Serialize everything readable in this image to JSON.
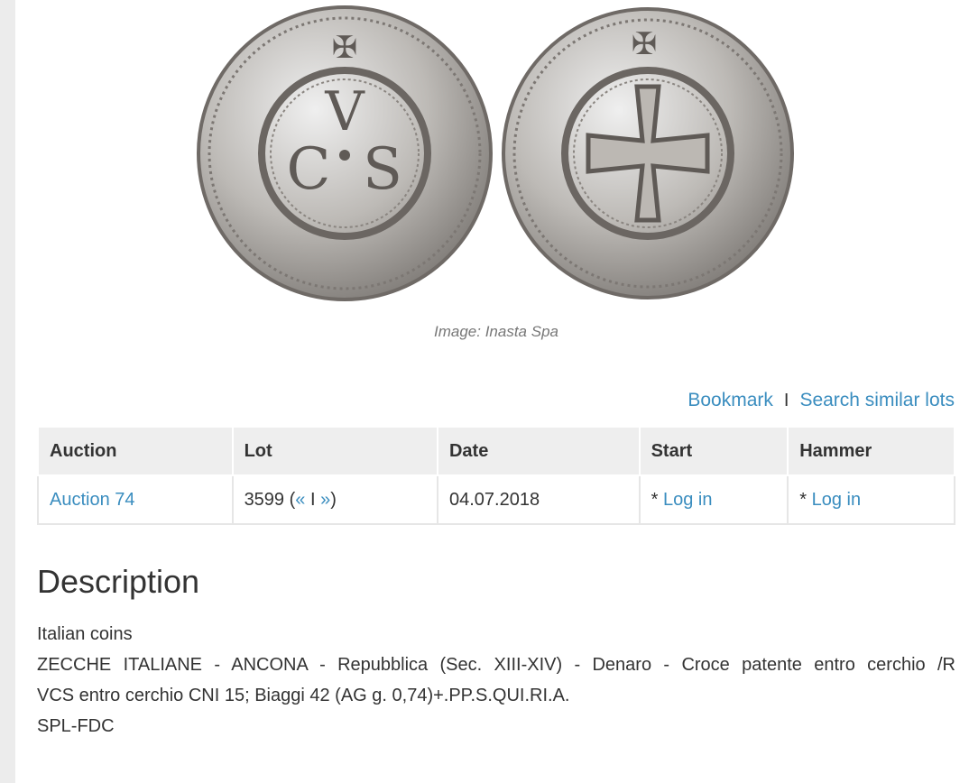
{
  "image": {
    "caption": "Image: Inasta Spa"
  },
  "actions": {
    "bookmark": "Bookmark",
    "separator": "I",
    "search_similar": "Search similar lots"
  },
  "table": {
    "headers": [
      "Auction",
      "Lot",
      "Date",
      "Start",
      "Hammer"
    ],
    "row": {
      "auction": "Auction 74",
      "lot_number": "3599",
      "lot_prev": "«",
      "lot_sep": "I",
      "lot_next": "»",
      "date": "04.07.2018",
      "start_prefix": "*",
      "start_link": "Log in",
      "hammer_prefix": "*",
      "hammer_link": "Log in"
    }
  },
  "description": {
    "title": "Description",
    "category": "Italian coins",
    "line1": "ZECCHE ITALIANE - ANCONA - Repubblica (Sec. XIII-XIV) - Denaro - Croce patente entro cerchio /R",
    "line2": "VCS entro cerchio CNI 15; Biaggi 42 (AG g. 0,74)+.PP.S.QUI.RI.A.",
    "grade": "SPL-FDC"
  },
  "colors": {
    "link": "#3a8dbf",
    "text": "#333333",
    "header_bg": "#eeeeee"
  }
}
